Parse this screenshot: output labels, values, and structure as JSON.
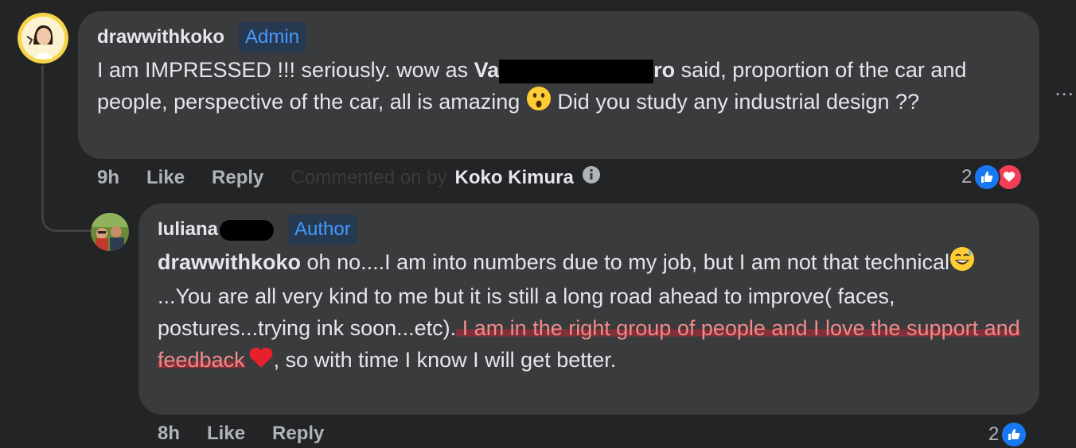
{
  "comment1": {
    "author": "drawwithkoko",
    "badge": "Admin",
    "text_before": "I am IMPRESSED !!! seriously. wow as ",
    "mention_start": "Va",
    "mention_end": "ro",
    "text_after": " said, proportion of the car and people, perspective of the car, all is amazing ",
    "emoji": "astonished-face",
    "text_end": " Did you study any industrial design ??",
    "time": "9h",
    "like": "Like",
    "reply": "Reply",
    "commented_on_by": "Commented on by",
    "commenter": "Koko Kimura",
    "reaction_count": "2",
    "reactions": [
      "like",
      "love"
    ]
  },
  "comment2": {
    "author": "Iuliana",
    "badge": "Author",
    "mention": "drawwithkoko",
    "text1": " oh no....I am into numbers due to my job, but I am not that technical",
    "emoji1": "grinning-face-with-sweat",
    "text2": "...You are all very kind to me but it is still a long road ahead to improve( faces, postures...trying ink soon...etc).",
    "highlighted": " I am in the right group of people and I love the support and feedback",
    "emoji2": "red-heart",
    "text3": ", so with time I know I will get better.",
    "time": "8h",
    "like": "Like",
    "reply": "Reply",
    "reaction_count": "2",
    "reactions": [
      "like"
    ]
  },
  "more_options": "...",
  "colors": {
    "background": "#232425",
    "bubble": "#3a3b3c",
    "badge_text": "#4599ff",
    "badge_bg": "#263951",
    "like_blue": "#1877f2",
    "love_red": "#f33e58",
    "highlight": "#be2837"
  }
}
